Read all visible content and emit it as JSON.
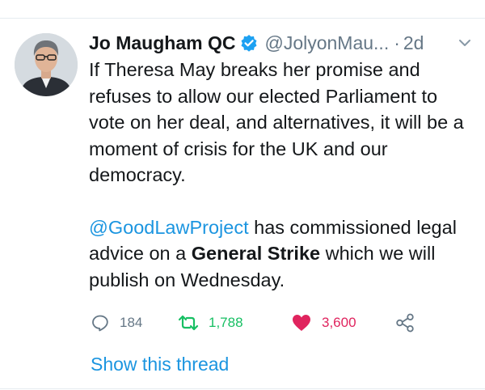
{
  "tweet": {
    "author_name": "Jo Maugham QC",
    "handle": "@JolyonMau...",
    "separator": "·",
    "time": "2d",
    "paragraph1": "If Theresa May breaks her promise and refuses to allow our elected Parliament to vote on her deal, and alternatives, it will be a moment of crisis for the UK and our democracy.",
    "paragraph2": {
      "mention": "@GoodLawProject",
      "text_a": " has commissioned legal advice on a ",
      "bold": "General Strike",
      "text_b": " which we will publish on Wednesday."
    }
  },
  "actions": {
    "reply_count": "184",
    "retweet_count": "1,788",
    "like_count": "3,600"
  },
  "thread_link": "Show this thread",
  "colors": {
    "link": "#1b95e0",
    "retweet": "#17bf63",
    "like": "#e0245e",
    "muted": "#657786",
    "text": "#14171a"
  },
  "icons": {
    "verified": "verified-badge-icon",
    "more": "chevron-down-icon",
    "reply": "reply-icon",
    "retweet": "retweet-icon",
    "like": "heart-icon",
    "share": "share-icon"
  }
}
